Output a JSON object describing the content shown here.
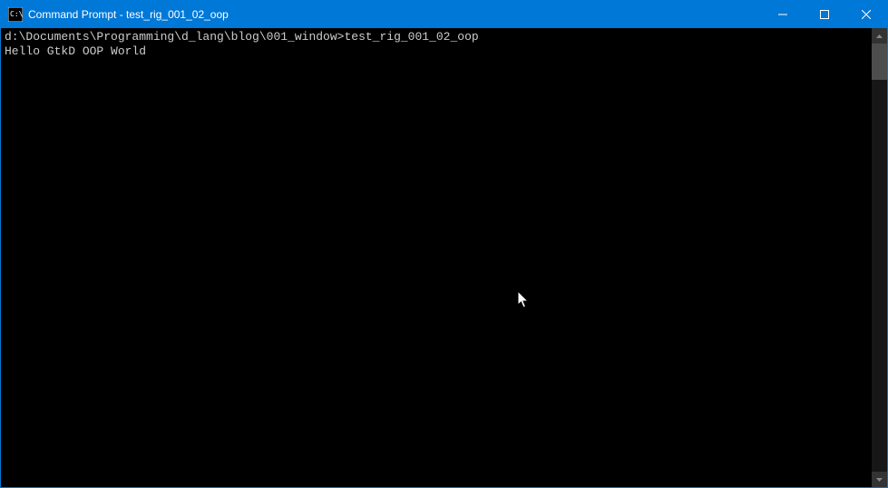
{
  "titlebar": {
    "app_name": "Command Prompt",
    "separator": " - ",
    "process_name": "test_rig_001_02_oop"
  },
  "terminal": {
    "prompt_path": "d:\\Documents\\Programming\\d_lang\\blog\\001_window>",
    "command": "test_rig_001_02_oop",
    "output_line1": "Hello GtkD OOP World"
  },
  "window_controls": {
    "minimize": "minimize",
    "maximize": "maximize",
    "close": "close"
  }
}
